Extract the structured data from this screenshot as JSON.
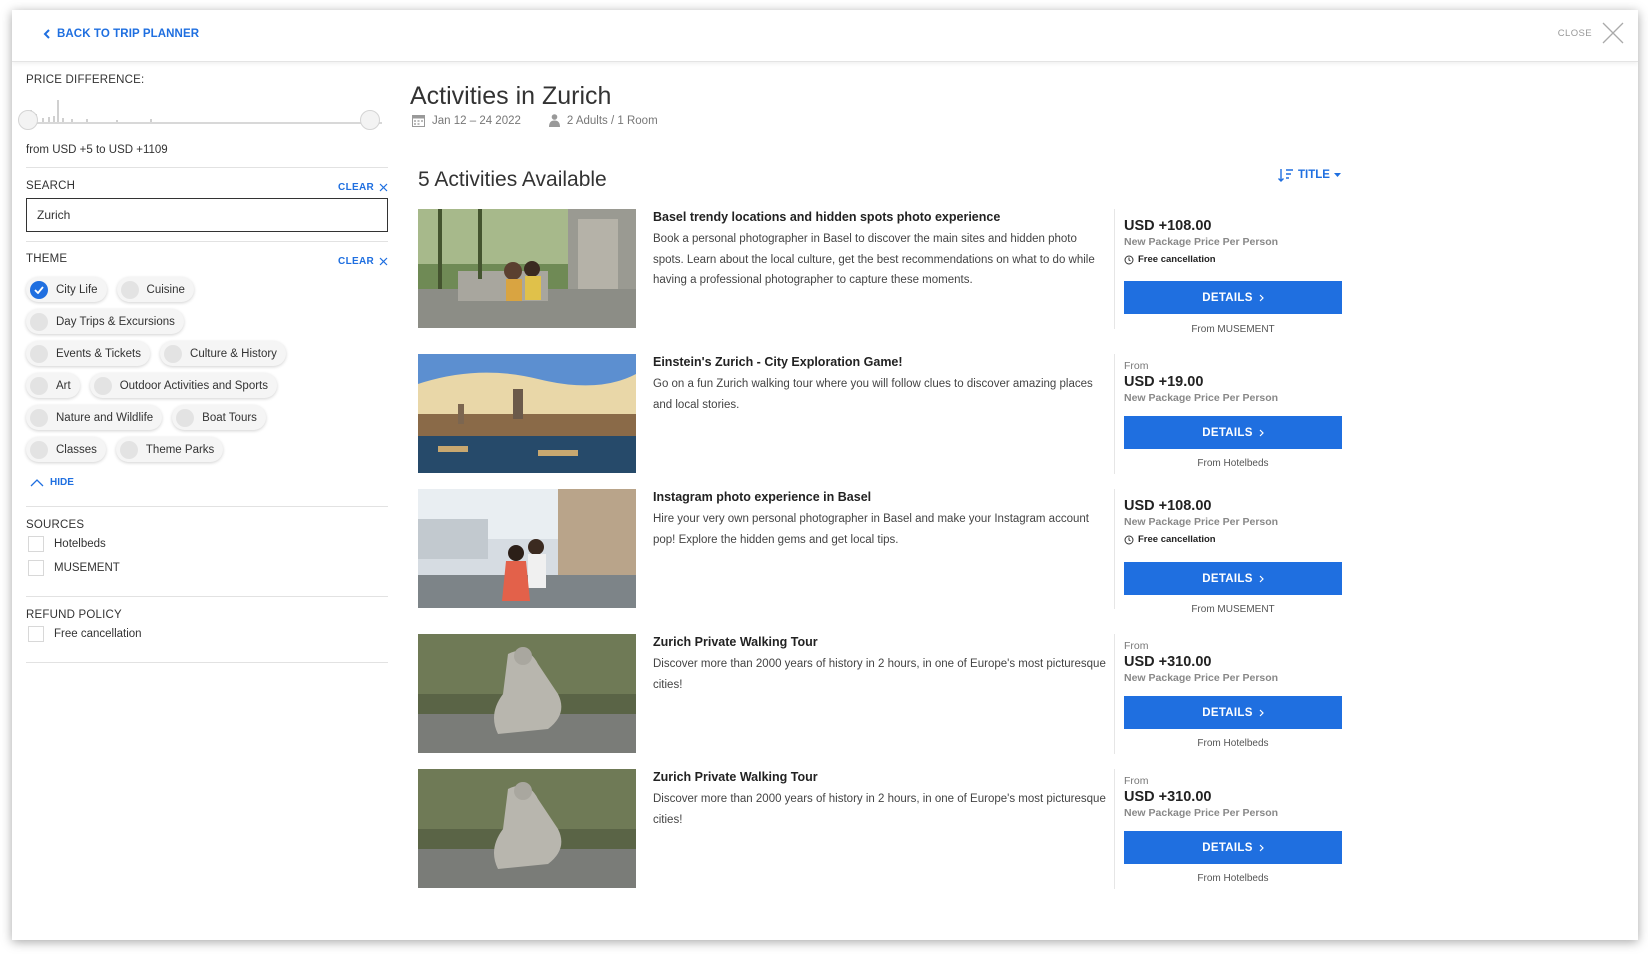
{
  "header": {
    "back_label": "BACK TO TRIP PLANNER",
    "close_label": "CLOSE"
  },
  "filters": {
    "price": {
      "label": "PRICE DIFFERENCE:",
      "range_text": "from USD +5 to USD +1109"
    },
    "search": {
      "label": "SEARCH",
      "clear_label": "CLEAR",
      "value": "Zurich"
    },
    "theme": {
      "label": "THEME",
      "clear_label": "CLEAR",
      "hide_label": "HIDE",
      "chips": [
        {
          "label": "City Life",
          "checked": true
        },
        {
          "label": "Cuisine",
          "checked": false
        },
        {
          "label": "Day Trips & Excursions",
          "checked": false
        },
        {
          "label": "Events & Tickets",
          "checked": false
        },
        {
          "label": "Culture & History",
          "checked": false
        },
        {
          "label": "Art",
          "checked": false
        },
        {
          "label": "Outdoor Activities and Sports",
          "checked": false
        },
        {
          "label": "Nature and Wildlife",
          "checked": false
        },
        {
          "label": "Boat Tours",
          "checked": false
        },
        {
          "label": "Classes",
          "checked": false
        },
        {
          "label": "Theme Parks",
          "checked": false
        }
      ]
    },
    "sources": {
      "label": "SOURCES",
      "options": [
        "Hotelbeds",
        "MUSEMENT"
      ]
    },
    "refund": {
      "label": "REFUND POLICY",
      "options": [
        "Free cancellation"
      ]
    }
  },
  "main": {
    "title": "Activities in Zurich",
    "dates": "Jan 12 – 24 2022",
    "guests": "2 Adults / 1 Room",
    "available": "5 Activities Available",
    "sort_label": "TITLE"
  },
  "activities": [
    {
      "title": "Basel trendy locations and hidden spots photo experience",
      "description": "Book a personal photographer in Basel to discover the main sites and hidden photo spots. Learn about the local culture, get the best recommendations on what to do while having a professional photographer to capture these moments.",
      "from_label": "",
      "price": "USD +108.00",
      "price_note": "New Package Price Per Person",
      "free_cancellation": "Free cancellation",
      "button_label": "DETAILS",
      "source": "From MUSEMENT"
    },
    {
      "title": "Einstein's Zurich - City Exploration Game!",
      "description": "Go on a fun Zurich walking tour where you will follow clues to discover amazing places and local stories.",
      "from_label": "From",
      "price": "USD +19.00",
      "price_note": "New Package Price Per Person",
      "free_cancellation": "",
      "button_label": "DETAILS",
      "source": "From Hotelbeds"
    },
    {
      "title": "Instagram photo experience in Basel",
      "description": "Hire your very own personal photographer in Basel and make your Instagram account pop! Explore the hidden gems and get local tips.",
      "from_label": "",
      "price": "USD +108.00",
      "price_note": "New Package Price Per Person",
      "free_cancellation": "Free cancellation",
      "button_label": "DETAILS",
      "source": "From MUSEMENT"
    },
    {
      "title": "Zurich Private Walking Tour",
      "description": "Discover more than 2000 years of history in 2 hours, in one of Europe's most picturesque cities!",
      "from_label": "From",
      "price": "USD +310.00",
      "price_note": "New Package Price Per Person",
      "free_cancellation": "",
      "button_label": "DETAILS",
      "source": "From Hotelbeds"
    },
    {
      "title": "Zurich Private Walking Tour",
      "description": "Discover more than 2000 years of history in 2 hours, in one of Europe's most picturesque cities!",
      "from_label": "From",
      "price": "USD +310.00",
      "price_note": "New Package Price Per Person",
      "free_cancellation": "",
      "button_label": "DETAILS",
      "source": "From Hotelbeds"
    }
  ],
  "colors": {
    "accent": "#1f6fe0",
    "text": "#333333",
    "muted": "#888888"
  }
}
